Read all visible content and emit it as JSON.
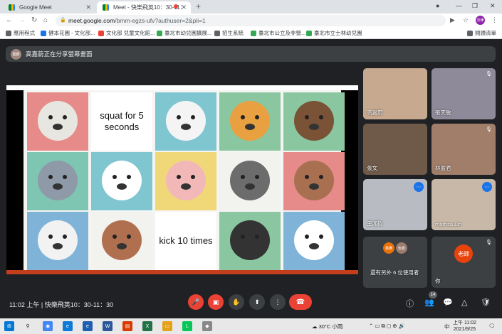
{
  "browser": {
    "tabs": [
      {
        "title": "Google Meet"
      },
      {
        "title": "Meet - 快樂飛英10：30-11："
      }
    ],
    "new_tab_symbol": "+",
    "url_host": "meet.google.com",
    "url_path": "/bmm-egzs-ufv?authuser=2&pli=1",
    "profile_initials": "法律",
    "bookmarks": [
      {
        "label": "應用程式",
        "color": "#5f6368"
      },
      {
        "label": "健本花園 - 文化部...",
        "color": "#1a73e8"
      },
      {
        "label": "文化部 兒童文化館...",
        "color": "#ea4335"
      },
      {
        "label": "臺北市幼兒園擴展...",
        "color": "#34a853"
      },
      {
        "label": "招生系統",
        "color": "#5f6368"
      },
      {
        "label": "臺北市公立及非營...",
        "color": "#34a853"
      },
      {
        "label": "臺北市立士林幼兒園",
        "color": "#34a853"
      }
    ],
    "reading_list": "閱讀清單"
  },
  "meet": {
    "presenter_banner": "高嘉蔚正在分享螢幕畫面",
    "presenter_initials": "嘉蔚",
    "slide": {
      "cells": [
        {
          "kind": "animal",
          "animal": "seal",
          "bg": "#e78a8a",
          "face": "#e8e6e0"
        },
        {
          "kind": "text",
          "text": "squat for 5 seconds"
        },
        {
          "kind": "animal",
          "animal": "polar-bear",
          "bg": "#7fc6d0",
          "face": "#f4f4f4"
        },
        {
          "kind": "animal",
          "animal": "fox",
          "bg": "#8ac7a0",
          "face": "#e8a040"
        },
        {
          "kind": "animal",
          "animal": "bear",
          "bg": "#8ac7a0",
          "face": "#7a5236"
        },
        {
          "kind": "animal",
          "animal": "wolf",
          "bg": "#7fc6b2",
          "face": "#8e9aa8"
        },
        {
          "kind": "animal",
          "animal": "cow",
          "bg": "#7fc6d0",
          "face": "#ffffff"
        },
        {
          "kind": "animal",
          "animal": "pig",
          "bg": "#f0d878",
          "face": "#f2b8b8"
        },
        {
          "kind": "animal",
          "animal": "cat",
          "bg": "#f2f2ee",
          "face": "#6c6c6c"
        },
        {
          "kind": "animal",
          "animal": "raccoon",
          "bg": "#e78a8a",
          "face": "#a87050"
        },
        {
          "kind": "animal",
          "animal": "sheep",
          "bg": "#7fb4d8",
          "face": "#f2f2f2"
        },
        {
          "kind": "animal",
          "animal": "horse",
          "bg": "#f2f2ee",
          "face": "#b07050"
        },
        {
          "kind": "text",
          "text": "kick 10 times"
        },
        {
          "kind": "animal",
          "animal": "dog",
          "bg": "#8ac7a0",
          "face": "#333333"
        },
        {
          "kind": "animal",
          "animal": "panda",
          "bg": "#7fb4d8",
          "face": "#ffffff"
        }
      ]
    },
    "participants": [
      {
        "name": "高嘉蔚",
        "bg": "#c7a98f",
        "icon": "none"
      },
      {
        "name": "張天敏",
        "bg": "#8f8a9a",
        "icon": "mic-off"
      },
      {
        "name": "張文",
        "bg": "#6f5a4a",
        "icon": "none"
      },
      {
        "name": "林盈君",
        "bg": "#a07e6a",
        "icon": "mic-off"
      },
      {
        "name": "王湘鈞",
        "bg": "#b8bcc2",
        "icon": "dots"
      },
      {
        "name": "marrisa Lin",
        "bg": "#c8b8a8",
        "icon": "dots"
      }
    ],
    "others": {
      "label": "還有另外 6 位使用者",
      "avatars": [
        {
          "initials": "黃鷹",
          "color": "#e8710a"
        },
        {
          "initials": "怡嘉",
          "color": "#9e7b6f"
        }
      ]
    },
    "self": {
      "name": "你",
      "initials": "老師"
    },
    "footer": {
      "time": "11:02 上午",
      "separator": "|",
      "meeting_title": "快樂飛英10：30-11：30",
      "people_count": "14"
    }
  },
  "taskbar": {
    "weather": "30°C 小雨",
    "ime": "中",
    "time": "上午 11:02",
    "date": "2021/9/25"
  }
}
